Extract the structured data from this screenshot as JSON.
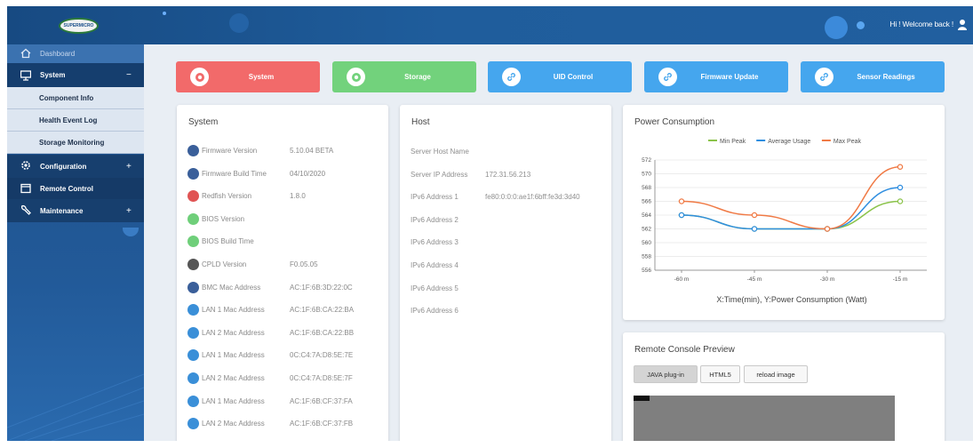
{
  "header": {
    "logo_text": "SUPERMICRO",
    "welcome": "Hi ! Welcome back !"
  },
  "sidebar": {
    "items": [
      {
        "label": "Dashboard",
        "icon": "home-icon"
      },
      {
        "label": "System",
        "icon": "monitor-icon",
        "toggle": "−"
      },
      {
        "label": "Component Info"
      },
      {
        "label": "Health Event Log"
      },
      {
        "label": "Storage Monitoring"
      },
      {
        "label": "Configuration",
        "icon": "gear-icon",
        "toggle": "+"
      },
      {
        "label": "Remote Control",
        "icon": "remote-screen-icon"
      },
      {
        "label": "Maintenance",
        "icon": "wrench-icon",
        "toggle": "+"
      }
    ]
  },
  "quick_buttons": [
    {
      "label": "System",
      "color": "#f26a6a",
      "icon": "system-icon"
    },
    {
      "label": "Storage",
      "color": "#72d27c",
      "icon": "storage-icon"
    },
    {
      "label": "UID Control",
      "color": "#45a6ee",
      "icon": "link-icon"
    },
    {
      "label": "Firmware Update",
      "color": "#45a6ee",
      "icon": "link-icon"
    },
    {
      "label": "Sensor Readings",
      "color": "#45a6ee",
      "icon": "link-icon"
    }
  ],
  "system_card": {
    "title": "System",
    "rows": [
      {
        "label": "Firmware Version",
        "value": "5.10.04 BETA",
        "color": "#3a5f9a"
      },
      {
        "label": "Firmware Build Time",
        "value": "04/10/2020",
        "color": "#3a5f9a"
      },
      {
        "label": "Redfish Version",
        "value": "1.8.0",
        "color": "#e05454"
      },
      {
        "label": "BIOS Version",
        "value": "",
        "color": "#6fcf7a"
      },
      {
        "label": "BIOS Build Time",
        "value": "",
        "color": "#6fcf7a"
      },
      {
        "label": "CPLD Version",
        "value": "F0.05.05",
        "color": "#555555"
      },
      {
        "label": "BMC Mac Address",
        "value": "AC:1F:6B:3D:22:0C",
        "color": "#3a5f9a"
      },
      {
        "label": "LAN 1 Mac Address",
        "value": "AC:1F:6B:CA:22:BA",
        "color": "#3a8fd8"
      },
      {
        "label": "LAN 2 Mac Address",
        "value": "AC:1F:6B:CA:22:BB",
        "color": "#3a8fd8"
      },
      {
        "label": "LAN 1 Mac Address",
        "value": "0C:C4:7A:D8:5E:7E",
        "color": "#3a8fd8"
      },
      {
        "label": "LAN 2 Mac Address",
        "value": "0C:C4:7A:D8:5E:7F",
        "color": "#3a8fd8"
      },
      {
        "label": "LAN 1 Mac Address",
        "value": "AC:1F:6B:CF:37:FA",
        "color": "#3a8fd8"
      },
      {
        "label": "LAN 2 Mac Address",
        "value": "AC:1F:6B:CF:37:FB",
        "color": "#3a8fd8"
      }
    ]
  },
  "host_card": {
    "title": "Host",
    "rows": [
      {
        "label": "Server Host Name",
        "value": ""
      },
      {
        "label": "Server IP Address",
        "value": "172.31.56.213"
      },
      {
        "label": "IPv6 Address 1",
        "value": "fe80:0:0:0:ae1f:6bff:fe3d:3d40"
      },
      {
        "label": "IPv6 Address 2",
        "value": ""
      },
      {
        "label": "IPv6 Address 3",
        "value": ""
      },
      {
        "label": "IPv6 Address 4",
        "value": ""
      },
      {
        "label": "IPv6 Address 5",
        "value": ""
      },
      {
        "label": "IPv6 Address 6",
        "value": ""
      }
    ]
  },
  "power_card": {
    "title": "Power Consumption"
  },
  "chart_data": {
    "type": "line",
    "xlabel": "X:Time(min), Y:Power Consumption (Watt)",
    "categories": [
      "-60 m",
      "-45 m",
      "-30 m",
      "-15 m"
    ],
    "ylim": [
      556,
      572
    ],
    "yticks": [
      556,
      558,
      560,
      562,
      564,
      566,
      568,
      570,
      572
    ],
    "legend_position": "top-center",
    "series": [
      {
        "name": "Min Peak",
        "color": "#8bc34a",
        "values": [
          564,
          562,
          562,
          566
        ]
      },
      {
        "name": "Average Usage",
        "color": "#2f8ee0",
        "values": [
          564,
          562,
          562,
          568
        ]
      },
      {
        "name": "Max Peak",
        "color": "#f07a45",
        "values": [
          566,
          564,
          562,
          571
        ]
      }
    ]
  },
  "console_card": {
    "title": "Remote Console Preview",
    "buttons": [
      "JAVA plug-in",
      "HTML5",
      "reload image"
    ]
  }
}
